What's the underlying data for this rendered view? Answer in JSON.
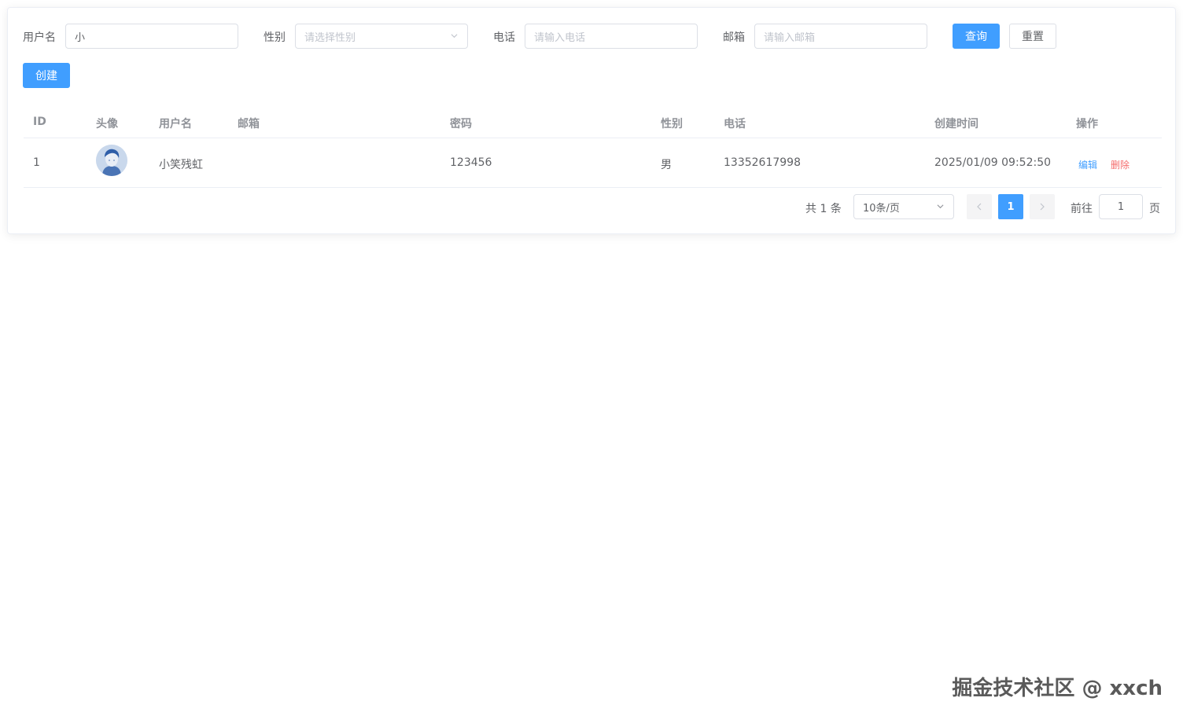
{
  "search": {
    "username_label": "用户名",
    "username_value": "小",
    "gender_label": "性别",
    "gender_placeholder": "请选择性别",
    "phone_label": "电话",
    "phone_placeholder": "请输入电话",
    "email_label": "邮箱",
    "email_placeholder": "请输入邮箱",
    "query_label": "查询",
    "reset_label": "重置"
  },
  "toolbar": {
    "create_label": "创建"
  },
  "table": {
    "columns": [
      "ID",
      "头像",
      "用户名",
      "邮箱",
      "密码",
      "性别",
      "电话",
      "创建时间",
      "操作"
    ],
    "rows": [
      {
        "id": "1",
        "username": "小笑残虹",
        "email": "",
        "password": "123456",
        "gender": "男",
        "phone": "13352617998",
        "created_at": "2025/01/09 09:52:50",
        "edit_label": "编辑",
        "delete_label": "删除"
      }
    ]
  },
  "pagination": {
    "total_text": "共 1 条",
    "page_size": "10条/页",
    "current_page": "1",
    "goto_label": "前往",
    "goto_value": "1",
    "page_suffix": "页"
  },
  "watermark": "掘金技术社区 @ xxch",
  "colors": {
    "primary": "#409eff",
    "danger": "#f56c6c"
  }
}
